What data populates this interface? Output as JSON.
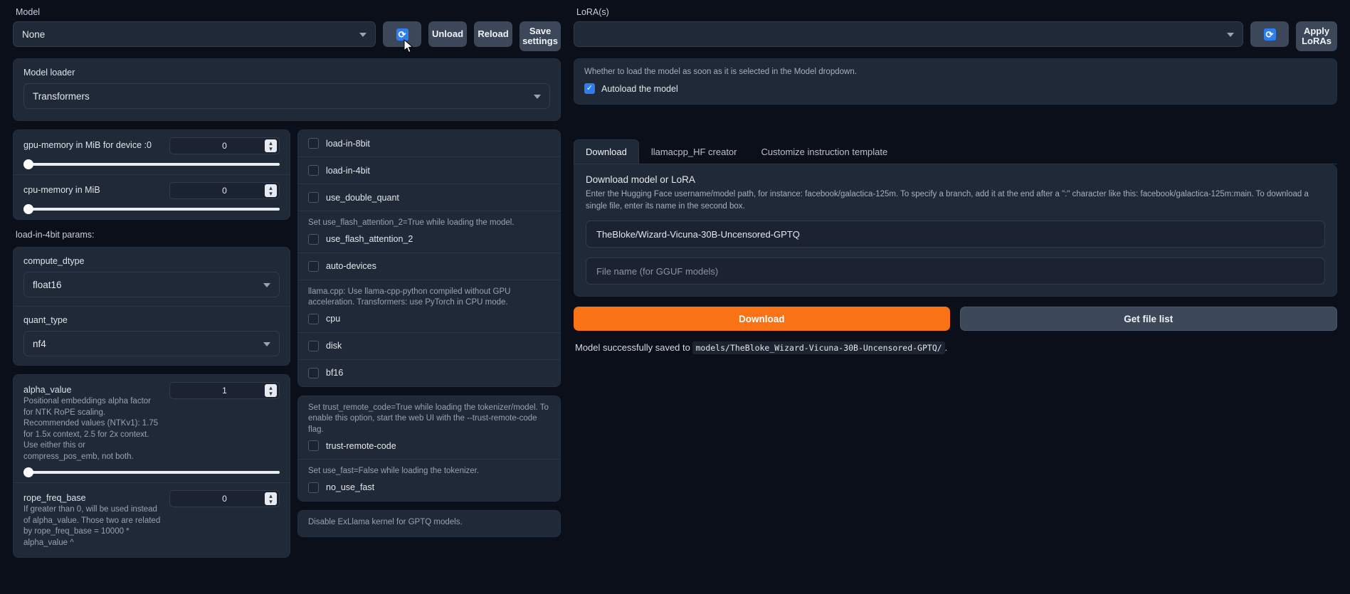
{
  "model_section": {
    "label": "Model",
    "selected": "None",
    "refresh_icon": "refresh-icon",
    "buttons": {
      "unload": "Unload",
      "reload": "Reload",
      "save_settings": "Save\nsettings"
    }
  },
  "lora_section": {
    "label": "LoRA(s)",
    "selected": "",
    "refresh_icon": "refresh-icon",
    "apply_button": "Apply\nLoRAs"
  },
  "model_loader": {
    "label": "Model loader",
    "selected": "Transformers"
  },
  "memory_sliders": [
    {
      "name": "gpu-memory in MiB for device :0",
      "value": "0",
      "fill": 0
    },
    {
      "name": "cpu-memory in MiB",
      "value": "0",
      "fill": 0
    }
  ],
  "load_in_4bit_heading": "load-in-4bit params:",
  "selects": [
    {
      "label": "compute_dtype",
      "value": "float16"
    },
    {
      "label": "quant_type",
      "value": "nf4"
    }
  ],
  "rope_sliders": [
    {
      "name": "alpha_value",
      "desc": "Positional embeddings alpha factor for NTK RoPE scaling. Recommended values (NTKv1): 1.75 for 1.5x context, 2.5 for 2x context. Use either this or compress_pos_emb, not both.",
      "value": "1",
      "fill": 0
    },
    {
      "name": "rope_freq_base",
      "desc": "If greater than 0, will be used instead of alpha_value. Those two are related by rope_freq_base = 10000 * alpha_value ^",
      "value": "0",
      "fill": 0
    }
  ],
  "checkbox_groups": [
    {
      "items": [
        {
          "label": "load-in-8bit",
          "checked": false,
          "hint": null
        },
        {
          "label": "load-in-4bit",
          "checked": false,
          "hint": null
        },
        {
          "label": "use_double_quant",
          "checked": false,
          "hint": null
        },
        {
          "label": "use_flash_attention_2",
          "checked": false,
          "hint": "Set use_flash_attention_2=True while loading the model."
        },
        {
          "label": "auto-devices",
          "checked": false,
          "hint": null
        },
        {
          "label": "cpu",
          "checked": false,
          "hint": "llama.cpp: Use llama-cpp-python compiled without GPU acceleration. Transformers: use PyTorch in CPU mode."
        },
        {
          "label": "disk",
          "checked": false,
          "hint": null
        },
        {
          "label": "bf16",
          "checked": false,
          "hint": null
        }
      ]
    },
    {
      "items": [
        {
          "label": "trust-remote-code",
          "checked": false,
          "hint": "Set trust_remote_code=True while loading the tokenizer/model. To enable this option, start the web UI with the --trust-remote-code flag."
        },
        {
          "label": "no_use_fast",
          "checked": false,
          "hint": "Set use_fast=False while loading the tokenizer."
        }
      ]
    },
    {
      "items": [
        {
          "label": "",
          "checked": false,
          "hint": "Disable ExLlama kernel for GPTQ models."
        }
      ]
    }
  ],
  "autoload": {
    "desc": "Whether to load the model as soon as it is selected in the Model dropdown.",
    "label": "Autoload the model",
    "checked": true
  },
  "tabs": [
    {
      "label": "Download",
      "active": true
    },
    {
      "label": "llamacpp_HF creator",
      "active": false
    },
    {
      "label": "Customize instruction template",
      "active": false
    }
  ],
  "download": {
    "title": "Download model or LoRA",
    "desc": "Enter the Hugging Face username/model path, for instance: facebook/galactica-125m. To specify a branch, add it at the end after a \":\" character like this: facebook/galactica-125m:main. To download a single file, enter its name in the second box.",
    "repo_value": "TheBloke/Wizard-Vicuna-30B-Uncensored-GPTQ",
    "file_placeholder": "File name (for GGUF models)",
    "file_value": "",
    "download_button": "Download",
    "get_file_list_button": "Get file list",
    "status_prefix": "Model successfully saved to",
    "status_path": "models/TheBloke_Wizard-Vicuna-30B-Uncensored-GPTQ/",
    "status_suffix": "."
  },
  "colors": {
    "accent_orange": "#f97316",
    "accent_blue": "#2f7ef0",
    "bg": "#0b0f19",
    "panel": "#1f2937"
  }
}
